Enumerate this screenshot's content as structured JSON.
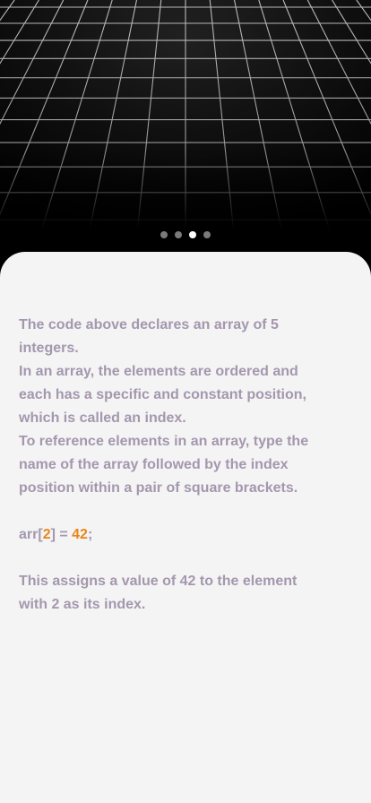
{
  "pager": {
    "count": 4,
    "active_index": 2
  },
  "content": {
    "paragraph_1": "The code above declares an array of 5 integers.",
    "paragraph_2": "In an array, the elements are ordered and each has a specific and constant position, which is called an index.",
    "paragraph_3": "To reference elements in an array, type the name of the array followed by the index position within a pair of square brackets.",
    "code": {
      "prefix": "arr[",
      "index": "2",
      "middle": "] = ",
      "value": "42",
      "suffix": ";"
    },
    "paragraph_4": "This assigns a value of 42 to the element with 2 as its index."
  },
  "colors": {
    "text": "#a497ae",
    "highlight": "#e8861a",
    "sheet": "#f4f4f4"
  }
}
